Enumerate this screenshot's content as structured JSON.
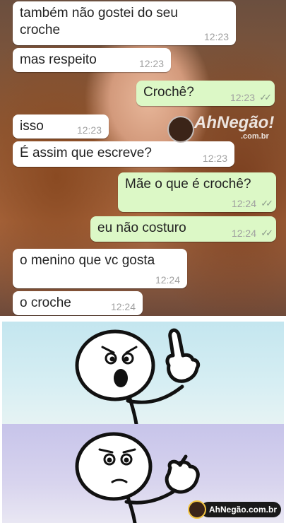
{
  "messages": [
    {
      "text": "também não gostei do seu",
      "text2": "croche",
      "time": "12:23",
      "dir": "in"
    },
    {
      "text": "mas respeito",
      "time": "12:23",
      "dir": "in"
    },
    {
      "text": "Crochê?",
      "time": "12:23",
      "dir": "out"
    },
    {
      "text": "isso",
      "time": "12:23",
      "dir": "in"
    },
    {
      "text": "É assim que escreve?",
      "time": "12:23",
      "dir": "in"
    },
    {
      "text": "Mãe o que é crochê?",
      "time": "12:24",
      "dir": "out"
    },
    {
      "text": "eu não costuro",
      "time": "12:24",
      "dir": "out"
    },
    {
      "text": "o menino que vc gosta",
      "time": "12:24",
      "dir": "in"
    },
    {
      "text": "o croche",
      "time": "12:24",
      "dir": "in"
    }
  ],
  "ticks": "✓✓",
  "watermark_chat": {
    "brand": "AhNegão!",
    "sub": ".com.br",
    "icon": "mascot-face-icon"
  },
  "watermark_footer": {
    "text": "AhNegão.com.br",
    "icon": "mascot-face-icon"
  },
  "colors": {
    "incoming": "#ffffff",
    "outgoing": "#dcf8c6",
    "panel_top": "#c4e6ef",
    "panel_bottom": "#c7c4ea"
  }
}
